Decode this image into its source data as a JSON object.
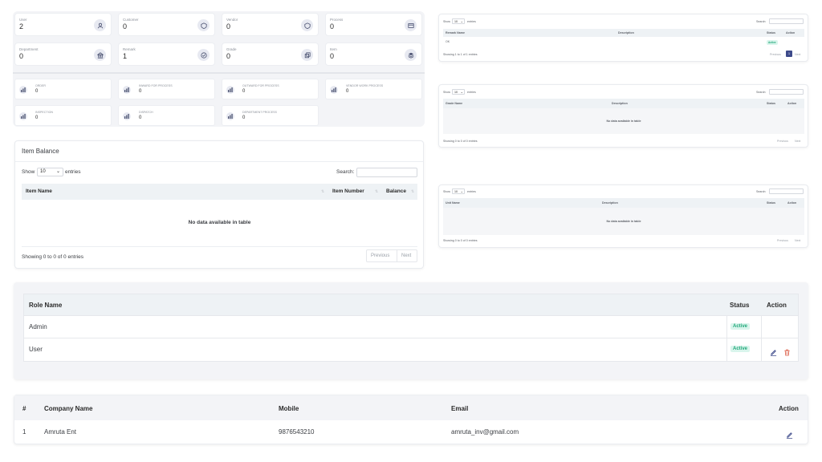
{
  "stats_row1": [
    {
      "label": "User",
      "value": "2",
      "icon": "user-icon"
    },
    {
      "label": "Customer",
      "value": "0",
      "icon": "customer-icon"
    },
    {
      "label": "Vendor",
      "value": "0",
      "icon": "vendor-icon"
    },
    {
      "label": "Process",
      "value": "0",
      "icon": "process-icon"
    }
  ],
  "stats_row2": [
    {
      "label": "Department",
      "value": "0",
      "icon": "department-icon"
    },
    {
      "label": "Remark",
      "value": "1",
      "icon": "remark-icon"
    },
    {
      "label": "Grade",
      "value": "0",
      "icon": "grade-icon"
    },
    {
      "label": "Item",
      "value": "0",
      "icon": "item-icon"
    }
  ],
  "mini_stats": [
    {
      "label": "ORDER",
      "value": "0"
    },
    {
      "label": "INWARD FOR PROCESS",
      "value": "0"
    },
    {
      "label": "OUTWARD FOR PROCESS",
      "value": "0"
    },
    {
      "label": "VENDOR WORK PROCESS",
      "value": "0"
    },
    {
      "label": "INSPECTION",
      "value": "0"
    },
    {
      "label": "DISPATCH",
      "value": "0"
    },
    {
      "label": "DEPARTMENT PROCESS",
      "value": "0"
    }
  ],
  "item_balance": {
    "title": "Item Balance",
    "show_label": "Show",
    "entries_value": "10",
    "entries_label": "entries",
    "search_label": "Search:",
    "columns": [
      "Item Name",
      "Item Number",
      "Balance"
    ],
    "empty": "No data available in table",
    "info": "Showing 0 to 0 of 0 entries",
    "prev": "Previous",
    "next": "Next"
  },
  "remark_table": {
    "show_label": "Show",
    "entries_value": "10",
    "entries_label": "entries",
    "search_label": "Search:",
    "columns": [
      "Remark Name",
      "Description",
      "Status",
      "Action"
    ],
    "row": {
      "name": "OK",
      "status": "Active"
    },
    "info": "Showing 1 to 1 of 1 entries",
    "prev": "Previous",
    "page": "1",
    "next": "Next"
  },
  "grade_table": {
    "show_label": "Show",
    "entries_value": "10",
    "entries_label": "entries",
    "search_label": "Search:",
    "columns": [
      "Grade Name",
      "Description",
      "Status",
      "Action"
    ],
    "empty": "No data available in table",
    "info": "Showing 0 to 0 of 0 entries",
    "prev": "Previous",
    "next": "Next"
  },
  "unit_table": {
    "show_label": "Show",
    "entries_value": "10",
    "entries_label": "entries",
    "search_label": "Search:",
    "columns": [
      "Unit Name",
      "Description",
      "Status",
      "Action"
    ],
    "empty": "No data available in table",
    "info": "Showing 0 to 0 of 0 entries",
    "prev": "Previous",
    "next": "Next"
  },
  "role_table": {
    "columns": [
      "Role Name",
      "Status",
      "Action"
    ],
    "rows": [
      {
        "name": "Admin",
        "status": "Active"
      },
      {
        "name": "User",
        "status": "Active"
      }
    ]
  },
  "company_table": {
    "columns": [
      "#",
      "Company Name",
      "Mobile",
      "Email",
      "Action"
    ],
    "rows": [
      {
        "num": "1",
        "name": "Amruta Ent",
        "mobile": "9876543210",
        "email": "amruta_inv@gmail.com"
      }
    ]
  },
  "colors": {
    "accent": "#3d4a8a",
    "active_bg": "#d9f5ec",
    "active_text": "#22a87a",
    "delete": "#e0705c"
  }
}
